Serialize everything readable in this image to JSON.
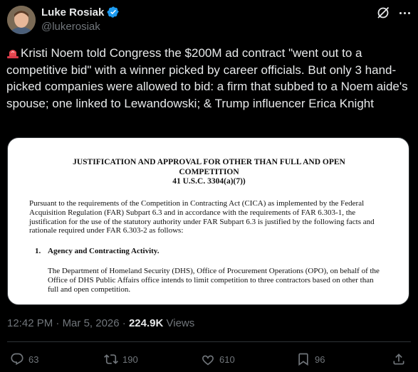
{
  "author": {
    "display_name": "Luke Rosiak",
    "handle": "@lukerosiak",
    "verified": true
  },
  "tweet": {
    "text": "Kristi Noem told Congress the $200M ad contract \"went out to a competitive bid\" with a winner picked by career officials. But only 3 hand-picked companies were allowed to bid: a firm that subbed to a Noem aide's spouse; one linked to Lewandowski; & Trump influencer Erica Knight",
    "leading_emoji": "rotating-light-icon"
  },
  "document": {
    "title_line1": "JUSTIFICATION AND APPROVAL FOR OTHER THAN FULL AND OPEN",
    "title_line2": "COMPETITION",
    "title_line3": "41 U.S.C. 3304(a)(7))",
    "paragraph1": "Pursuant to the requirements of the Competition in Contracting Act (CICA) as implemented by the Federal Acquisition Regulation (FAR) Subpart 6.3 and in accordance with the requirements of FAR 6.303-1, the justification for the use of the statutory authority under FAR Subpart 6.3 is justified by the following facts and rationale required under FAR 6.303-2 as follows:",
    "section_number": "1.",
    "section_heading": "Agency and Contracting Activity.",
    "paragraph2": "The Department of Homeland Security (DHS), Office of Procurement Operations (OPO), on behalf of the Office of DHS Public Affairs office intends to limit competition to three contractors based on other than full and open competition."
  },
  "meta": {
    "time": "12:42 PM",
    "separator": " · ",
    "date": "Mar 5, 2026",
    "views_count": "224.9K",
    "views_label": "Views"
  },
  "actions": {
    "replies": "63",
    "reposts": "190",
    "likes": "610",
    "bookmarks": "96"
  },
  "colors": {
    "background": "#000000",
    "text": "#e7e9ea",
    "muted": "#71767b",
    "verified": "#1d9bf0",
    "divider": "#2f3336"
  }
}
